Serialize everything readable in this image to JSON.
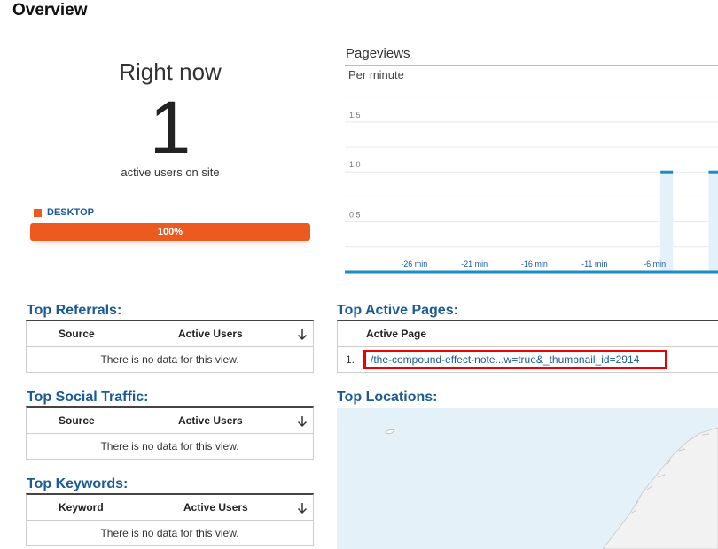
{
  "page": {
    "title": "Overview"
  },
  "right_now": {
    "title": "Right now",
    "count": "1",
    "subtitle": "active users on site",
    "device": {
      "label": "DESKTOP",
      "percent_label": "100%",
      "fraction": 1.0,
      "color": "#ec5a1f"
    }
  },
  "pageviews": {
    "title": "Pageviews",
    "subtitle": "Per minute"
  },
  "chart_data": {
    "type": "bar",
    "title": "Pageviews",
    "subtitle": "Per minute",
    "y_ticks": [
      "0.5",
      "1.0",
      "1.5"
    ],
    "ylim": [
      0,
      1.8
    ],
    "x_ticks": [
      "-26 min",
      "-21 min",
      "-16 min",
      "-11 min",
      "-6 min"
    ],
    "bars": [
      {
        "x": -5,
        "value": 1
      },
      {
        "x": -1,
        "value": 1
      }
    ],
    "series_color": "#1a8cc7",
    "grid": true
  },
  "top_referrals": {
    "title": "Top Referrals:",
    "columns": [
      "Source",
      "Active Users"
    ],
    "empty": "There is no data for this view."
  },
  "top_social": {
    "title": "Top Social Traffic:",
    "columns": [
      "Source",
      "Active Users"
    ],
    "empty": "There is no data for this view."
  },
  "top_keywords": {
    "title": "Top Keywords:",
    "columns": [
      "Keyword",
      "Active Users"
    ],
    "empty": "There is no data for this view."
  },
  "top_active_pages": {
    "title": "Top Active Pages:",
    "column": "Active Page",
    "rows": [
      {
        "num": "1.",
        "page": "/the-compound-effect-note...w=true&_thumbnail_id=2914"
      }
    ]
  },
  "top_locations": {
    "title": "Top Locations:"
  }
}
